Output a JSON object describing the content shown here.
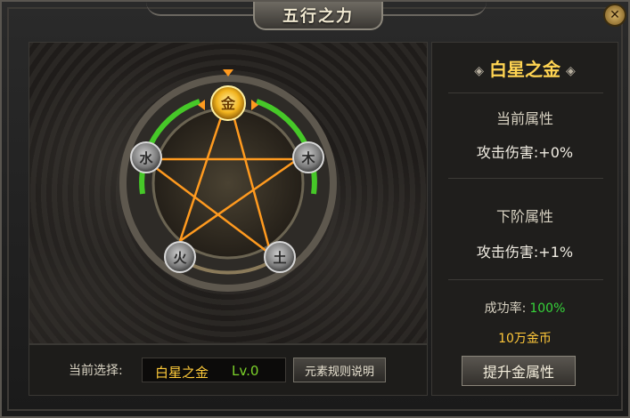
{
  "window": {
    "title": "五行之力",
    "close_icon": "close-icon"
  },
  "wheel": {
    "nodes": [
      {
        "glyph": "金",
        "state": "selected"
      },
      {
        "glyph": "木",
        "state": "inactive"
      },
      {
        "glyph": "水",
        "state": "inactive"
      },
      {
        "glyph": "火",
        "state": "inactive"
      },
      {
        "glyph": "土",
        "state": "inactive"
      }
    ],
    "colors": {
      "active_ring": "#46c828",
      "pentagram": "#ff9a1f",
      "selected": "#ffd23a"
    }
  },
  "bottom": {
    "select_label": "当前选择:",
    "selected_name": "白星之金",
    "selected_level": "Lv.0",
    "rules_button": "元素规则说明"
  },
  "details": {
    "title": "白星之金",
    "current_header": "当前属性",
    "current_attr": "攻击伤害:+0%",
    "next_header": "下阶属性",
    "next_attr": "攻击伤害:+1%",
    "success_label": "成功率:",
    "success_value": "100%",
    "cost": "10万金币",
    "upgrade_button": "提升金属性"
  }
}
